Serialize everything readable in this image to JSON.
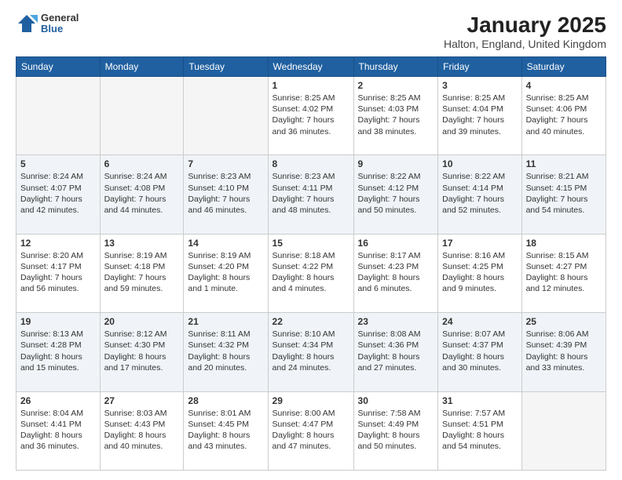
{
  "logo": {
    "general": "General",
    "blue": "Blue"
  },
  "title": "January 2025",
  "location": "Halton, England, United Kingdom",
  "weekdays": [
    "Sunday",
    "Monday",
    "Tuesday",
    "Wednesday",
    "Thursday",
    "Friday",
    "Saturday"
  ],
  "weeks": [
    [
      {
        "day": "",
        "info": ""
      },
      {
        "day": "",
        "info": ""
      },
      {
        "day": "",
        "info": ""
      },
      {
        "day": "1",
        "info": "Sunrise: 8:25 AM\nSunset: 4:02 PM\nDaylight: 7 hours and 36 minutes."
      },
      {
        "day": "2",
        "info": "Sunrise: 8:25 AM\nSunset: 4:03 PM\nDaylight: 7 hours and 38 minutes."
      },
      {
        "day": "3",
        "info": "Sunrise: 8:25 AM\nSunset: 4:04 PM\nDaylight: 7 hours and 39 minutes."
      },
      {
        "day": "4",
        "info": "Sunrise: 8:25 AM\nSunset: 4:06 PM\nDaylight: 7 hours and 40 minutes."
      }
    ],
    [
      {
        "day": "5",
        "info": "Sunrise: 8:24 AM\nSunset: 4:07 PM\nDaylight: 7 hours and 42 minutes."
      },
      {
        "day": "6",
        "info": "Sunrise: 8:24 AM\nSunset: 4:08 PM\nDaylight: 7 hours and 44 minutes."
      },
      {
        "day": "7",
        "info": "Sunrise: 8:23 AM\nSunset: 4:10 PM\nDaylight: 7 hours and 46 minutes."
      },
      {
        "day": "8",
        "info": "Sunrise: 8:23 AM\nSunset: 4:11 PM\nDaylight: 7 hours and 48 minutes."
      },
      {
        "day": "9",
        "info": "Sunrise: 8:22 AM\nSunset: 4:12 PM\nDaylight: 7 hours and 50 minutes."
      },
      {
        "day": "10",
        "info": "Sunrise: 8:22 AM\nSunset: 4:14 PM\nDaylight: 7 hours and 52 minutes."
      },
      {
        "day": "11",
        "info": "Sunrise: 8:21 AM\nSunset: 4:15 PM\nDaylight: 7 hours and 54 minutes."
      }
    ],
    [
      {
        "day": "12",
        "info": "Sunrise: 8:20 AM\nSunset: 4:17 PM\nDaylight: 7 hours and 56 minutes."
      },
      {
        "day": "13",
        "info": "Sunrise: 8:19 AM\nSunset: 4:18 PM\nDaylight: 7 hours and 59 minutes."
      },
      {
        "day": "14",
        "info": "Sunrise: 8:19 AM\nSunset: 4:20 PM\nDaylight: 8 hours and 1 minute."
      },
      {
        "day": "15",
        "info": "Sunrise: 8:18 AM\nSunset: 4:22 PM\nDaylight: 8 hours and 4 minutes."
      },
      {
        "day": "16",
        "info": "Sunrise: 8:17 AM\nSunset: 4:23 PM\nDaylight: 8 hours and 6 minutes."
      },
      {
        "day": "17",
        "info": "Sunrise: 8:16 AM\nSunset: 4:25 PM\nDaylight: 8 hours and 9 minutes."
      },
      {
        "day": "18",
        "info": "Sunrise: 8:15 AM\nSunset: 4:27 PM\nDaylight: 8 hours and 12 minutes."
      }
    ],
    [
      {
        "day": "19",
        "info": "Sunrise: 8:13 AM\nSunset: 4:28 PM\nDaylight: 8 hours and 15 minutes."
      },
      {
        "day": "20",
        "info": "Sunrise: 8:12 AM\nSunset: 4:30 PM\nDaylight: 8 hours and 17 minutes."
      },
      {
        "day": "21",
        "info": "Sunrise: 8:11 AM\nSunset: 4:32 PM\nDaylight: 8 hours and 20 minutes."
      },
      {
        "day": "22",
        "info": "Sunrise: 8:10 AM\nSunset: 4:34 PM\nDaylight: 8 hours and 24 minutes."
      },
      {
        "day": "23",
        "info": "Sunrise: 8:08 AM\nSunset: 4:36 PM\nDaylight: 8 hours and 27 minutes."
      },
      {
        "day": "24",
        "info": "Sunrise: 8:07 AM\nSunset: 4:37 PM\nDaylight: 8 hours and 30 minutes."
      },
      {
        "day": "25",
        "info": "Sunrise: 8:06 AM\nSunset: 4:39 PM\nDaylight: 8 hours and 33 minutes."
      }
    ],
    [
      {
        "day": "26",
        "info": "Sunrise: 8:04 AM\nSunset: 4:41 PM\nDaylight: 8 hours and 36 minutes."
      },
      {
        "day": "27",
        "info": "Sunrise: 8:03 AM\nSunset: 4:43 PM\nDaylight: 8 hours and 40 minutes."
      },
      {
        "day": "28",
        "info": "Sunrise: 8:01 AM\nSunset: 4:45 PM\nDaylight: 8 hours and 43 minutes."
      },
      {
        "day": "29",
        "info": "Sunrise: 8:00 AM\nSunset: 4:47 PM\nDaylight: 8 hours and 47 minutes."
      },
      {
        "day": "30",
        "info": "Sunrise: 7:58 AM\nSunset: 4:49 PM\nDaylight: 8 hours and 50 minutes."
      },
      {
        "day": "31",
        "info": "Sunrise: 7:57 AM\nSunset: 4:51 PM\nDaylight: 8 hours and 54 minutes."
      },
      {
        "day": "",
        "info": ""
      }
    ]
  ]
}
